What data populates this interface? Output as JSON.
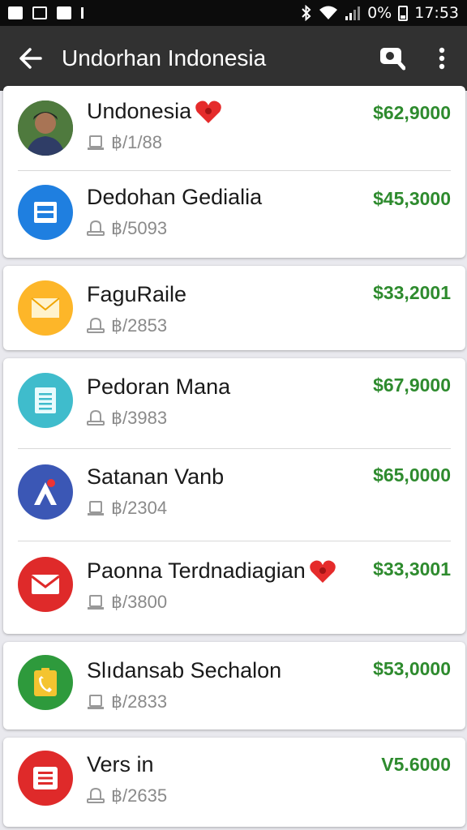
{
  "status": {
    "battery": "0%",
    "time": "17:53"
  },
  "appbar": {
    "title": "Undorhan Indonesia"
  },
  "items": [
    {
      "name": "Undonesia",
      "heart": true,
      "meta": "฿/1/88",
      "price": "$62,9000",
      "icon": "profile-photo",
      "color": "#3a5a3a"
    },
    {
      "name": "Dedohan Gedialia",
      "heart": false,
      "meta": "฿/5093",
      "price": "$45,3000",
      "icon": "document-icon",
      "color": "#1f7fe0"
    },
    {
      "name": "FaguRaile",
      "heart": false,
      "meta": "฿/2853",
      "price": "$33,2001",
      "icon": "envelope-icon",
      "color": "#fdb629"
    },
    {
      "name": "Pedoran Mana",
      "heart": false,
      "meta": "฿/3983",
      "price": "$67,9000",
      "icon": "notes-icon",
      "color": "#3fbccc"
    },
    {
      "name": "Satanan Vanb",
      "heart": false,
      "meta": "฿/2304",
      "price": "$65,0000",
      "icon": "app-logo-icon",
      "color": "#3b57b5"
    },
    {
      "name": "Paonna Terdnadiagian",
      "heart": true,
      "meta": "฿/3800",
      "price": "$33,3001",
      "icon": "mail-icon",
      "color": "#df2a2a"
    },
    {
      "name": "Slıdansab Sechalon",
      "heart": false,
      "meta": "฿/2833",
      "price": "$53,0000",
      "icon": "phone-icon",
      "color": "#2e9a3c"
    },
    {
      "name": "Vers in",
      "heart": false,
      "meta": "฿/2635",
      "price": "V5.6000",
      "icon": "list-icon",
      "color": "#df2a2a"
    }
  ]
}
